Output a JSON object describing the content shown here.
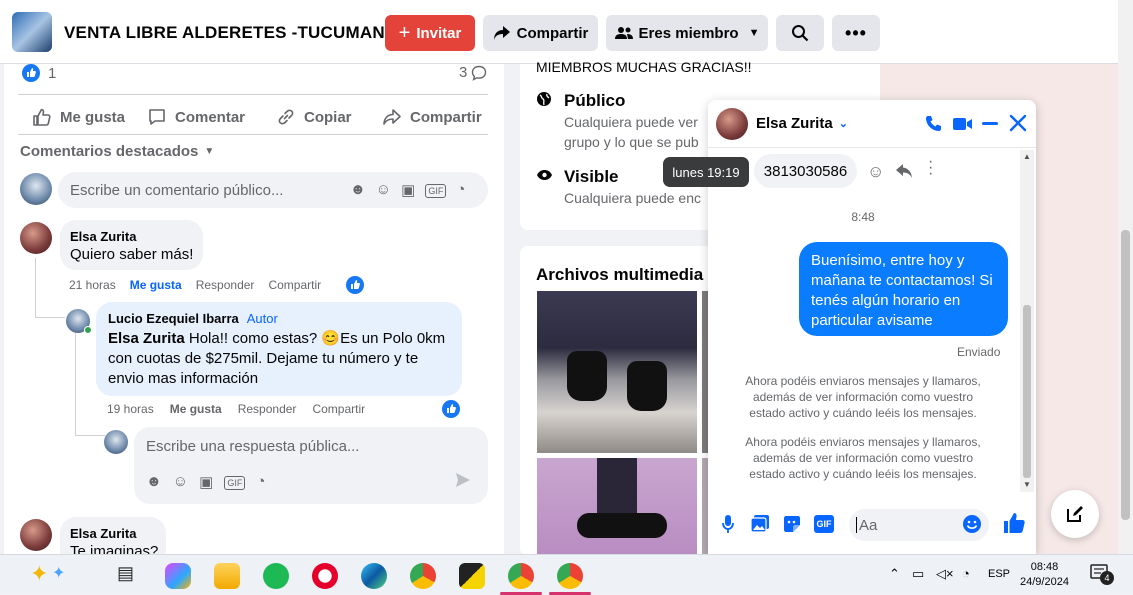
{
  "header": {
    "group_name": "VENTA LIBRE ALDERETES -TUCUMAN",
    "invite_label": "Invitar",
    "share_label": "Compartir",
    "member_label": "Eres miembro"
  },
  "post": {
    "reaction_count": "1",
    "comment_count": "3",
    "like_label": "Me gusta",
    "comment_label": "Comentar",
    "copy_label": "Copiar",
    "share_label": "Compartir",
    "featured_label": "Comentarios destacados",
    "comment_placeholder": "Escribe un comentario público..."
  },
  "comments": [
    {
      "author": "Elsa Zurita",
      "text": "Quiero saber más!",
      "time": "21 horas",
      "like": "Me gusta",
      "reply": "Responder",
      "share": "Compartir"
    },
    {
      "author": "Lucio Ezequiel Ibarra",
      "badge": "Autor",
      "mention": "Elsa Zurita",
      "text": " Hola!! como estas? 😊Es un Polo 0km con cuotas de $275mil. Dejame tu número y te envio mas información",
      "time": "19 horas",
      "like": "Me gusta",
      "reply": "Responder",
      "share": "Compartir"
    },
    {
      "author": "Elsa Zurita",
      "text": "Te imaginas?"
    }
  ],
  "reply_placeholder": "Escribe una respuesta pública...",
  "about": {
    "top_text": "MIEMBROS MUCHAS GRACIAS!!",
    "public_title": "Público",
    "public_desc_1": "Cualquiera puede ver",
    "public_desc_2": "grupo y lo que se pub",
    "visible_title": "Visible",
    "visible_desc": "Cualquiera puede enc"
  },
  "media": {
    "title": "Archivos multimedia re"
  },
  "chat": {
    "contact_name": "Elsa Zurita",
    "tooltip": "lunes 19:19",
    "received_number": "3813030586",
    "time_label": "8:48",
    "sent_message": "Buenísimo, entre hoy y mañana te contactamos! Si tenés algún horario en particular avisame",
    "sent_status": "Enviado",
    "system_msg_1": "Ahora podéis enviaros mensajes y llamaros, además de ver información como vuestro estado activo y cuándo leéis los mensajes.",
    "system_msg_2": "Ahora podéis enviaros mensajes y llamaros, además de ver información como vuestro estado activo y cuándo leéis los mensajes.",
    "input_placeholder": "Aa"
  },
  "taskbar": {
    "lang": "ESP",
    "time": "08:48",
    "date": "24/9/2024",
    "notif_count": "4"
  },
  "colors": {
    "accent": "#0866ff",
    "invite_red": "#e4433a",
    "bubble_blue": "#0a7cff"
  }
}
